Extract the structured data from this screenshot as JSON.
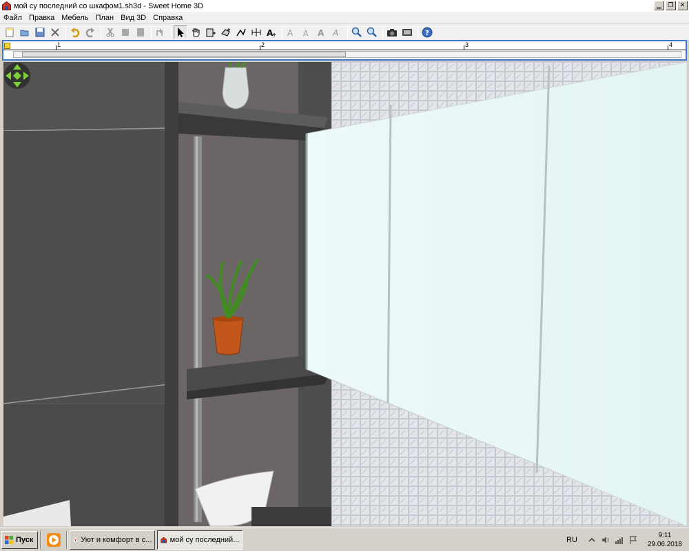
{
  "window": {
    "title": "мой су последний со шкафом1.sh3d - Sweet Home 3D",
    "controls": [
      "minimize-icon",
      "restore-icon",
      "close-icon"
    ]
  },
  "menu": {
    "items": [
      "Файл",
      "Правка",
      "Мебель",
      "План",
      "Вид 3D",
      "Справка"
    ]
  },
  "toolbar": {
    "buttons": [
      "new-file-icon",
      "open-icon",
      "save-icon",
      "cut-tool-icon",
      "undo-icon",
      "redo-icon",
      "cut-icon",
      "copy-icon",
      "paste-icon",
      "add-furniture-icon",
      "select-icon",
      "pan-icon",
      "create-walls-icon",
      "create-rooms-icon",
      "create-polylines-icon",
      "create-dimensions-icon",
      "add-text-icon",
      "text-style-icon",
      "text-style-icon",
      "bold-icon",
      "italic-icon",
      "zoom-in-icon",
      "zoom-out-icon",
      "create-photo-icon",
      "create-video-icon",
      "help-icon"
    ],
    "pressed_index": 10
  },
  "ruler": {
    "labels": [
      "1",
      "2",
      "3",
      "4"
    ]
  },
  "taskbar": {
    "start_label": "Пуск",
    "tasks": [
      {
        "label": "Уют и комфорт в с...",
        "icon": "yandex-browser-icon",
        "active": false
      },
      {
        "label": "мой су последний...",
        "icon": "sweet-home-3d-icon",
        "active": true
      }
    ],
    "language": "RU",
    "time": "9:11",
    "date": "29.06.2018"
  },
  "colors": {
    "titlebar": "#ffffff",
    "menubar": "#f0f0f0",
    "plan_border": "#3b7bcf",
    "wall_dark": "#4f4e4e",
    "niche_back": "#6b6665",
    "window_glass": "#e8f7f6",
    "tile": "#dadbe0",
    "pot": "#c2561b",
    "leaves": "#3f8d1f"
  }
}
